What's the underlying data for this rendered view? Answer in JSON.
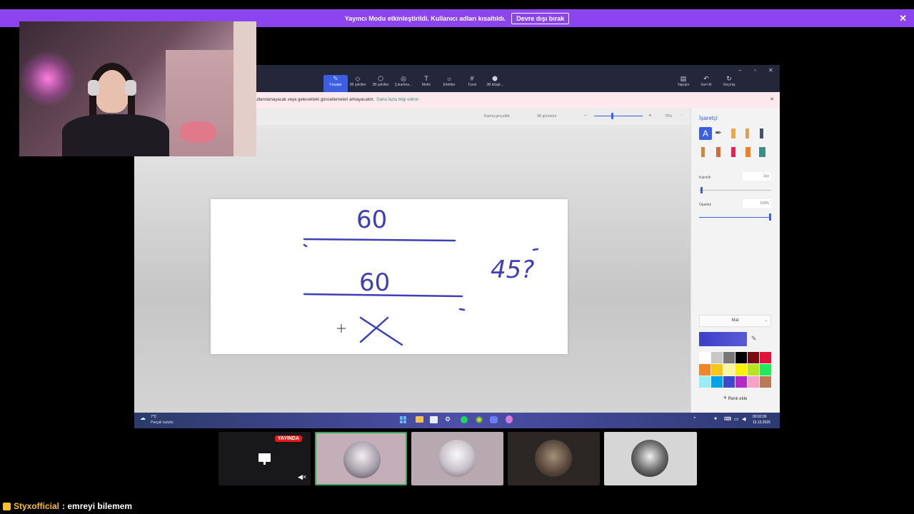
{
  "banner": {
    "message": "Yayıncı Modu etkinleştirildi. Kullanıcı adları kısaltıldı.",
    "button": "Devre dışı bırak",
    "close_icon": "close-icon"
  },
  "paint": {
    "tools": [
      {
        "label": "Fırçalar",
        "icon": "brush-icon"
      },
      {
        "label": "2B şekiller",
        "icon": "shapes-2d-icon"
      },
      {
        "label": "3B şekiller",
        "icon": "shapes-3d-icon"
      },
      {
        "label": "Çıkartma...",
        "icon": "sticker-icon"
      },
      {
        "label": "Metin",
        "icon": "text-icon"
      },
      {
        "label": "Efektler",
        "icon": "effects-icon"
      },
      {
        "label": "Tuval",
        "icon": "canvas-icon"
      },
      {
        "label": "3B kitapl...",
        "icon": "library-3d-icon"
      }
    ],
    "right_tools": [
      {
        "label": "Yapıştır",
        "icon": "paste-icon"
      },
      {
        "label": "Geri Al",
        "icon": "undo-icon"
      },
      {
        "label": "Geçmiş",
        "icon": "history-icon"
      }
    ],
    "infobar_text": "ullanılamayacak veya gelecekteki güncellemeleri almayacaktır.",
    "infobar_link": "Daha fazla bilgi edinin",
    "toolbar2": {
      "mixed_reality": "Karma gerçeklik",
      "view3d": "3B görünüm",
      "zoom": "75%"
    },
    "side": {
      "title": "İşaretçi",
      "thickness_label": "Kalınlık",
      "thickness_value": "1px",
      "opacity_label": "Opaklık",
      "opacity_value": "100%",
      "finish": "Mat",
      "add_color": "Renk ekle"
    },
    "palette": [
      "#ffffff",
      "#c8c8c8",
      "#777777",
      "#000000",
      "#7a0a12",
      "#e3123b",
      "#f08628",
      "#f7c719",
      "#fdf6a0",
      "#fff200",
      "#b5e61d",
      "#22e85b",
      "#99ecfa",
      "#00a2e8",
      "#3f48cc",
      "#b12bc4",
      "#f7a1c9",
      "#b97a57"
    ],
    "current_color": "#3c3fc7"
  },
  "taskbar": {
    "weather_temp": "7°C",
    "weather_text": "Parçalı bulutlu",
    "time": "00:02:09",
    "date": "15.10.2025"
  },
  "drawing_text": {
    "top": "60",
    "middle": "60",
    "bottom": "X",
    "side": "45?"
  },
  "tiles": {
    "live_label": "YAYINDA"
  },
  "chat": {
    "username": "Styxofficial",
    "message": ": emreyi bilemem"
  }
}
